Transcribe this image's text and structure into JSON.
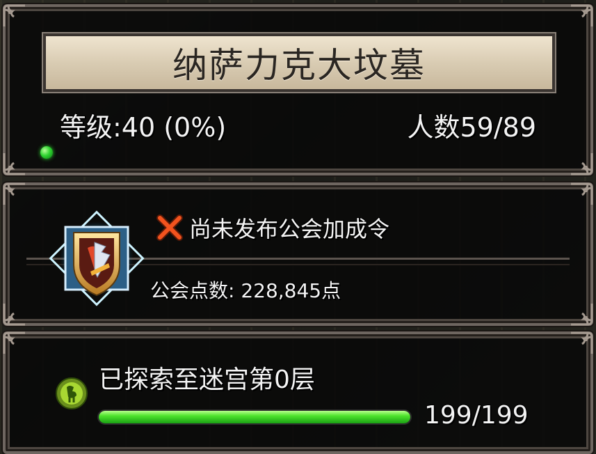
{
  "guild": {
    "name": "纳萨力克大坟墓",
    "level_text": "等级:40 (0%)",
    "members_text": "人数59/89",
    "online_status_color": "#2fd431"
  },
  "decree": {
    "icon": "red-x-icon",
    "text": "尚未发布公会加成令"
  },
  "guild_points": {
    "text": "公会点数: 228,845点"
  },
  "emblem": {
    "icon": "guild-shield-emblem-icon"
  },
  "labyrinth": {
    "icon": "maze-green-icon",
    "text": "已探索至迷宫第0层",
    "progress": 1.0,
    "progress_text": "199/199"
  }
}
